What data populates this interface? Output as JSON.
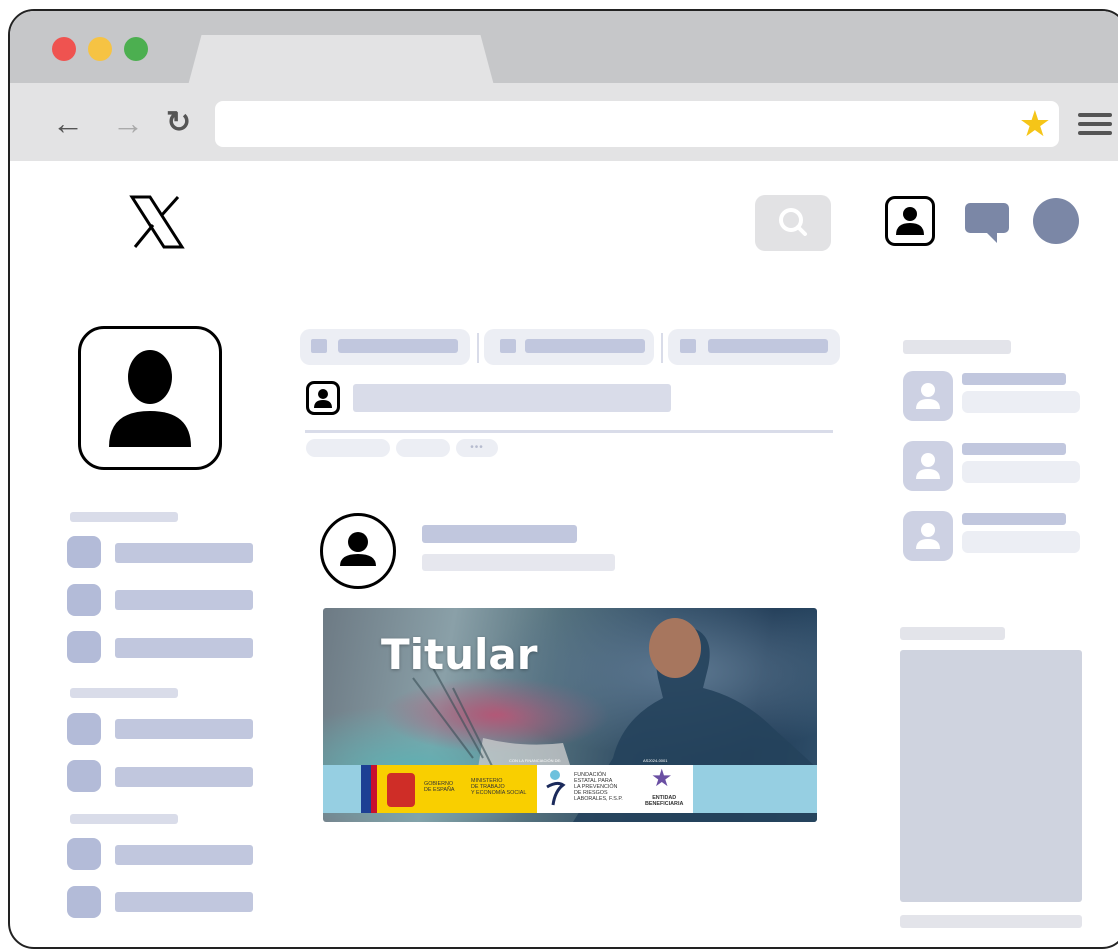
{
  "browser": {
    "traffic_lights": [
      "#ef5350",
      "#f6c343",
      "#4caf50"
    ],
    "back_icon": "arrow-left-icon",
    "forward_icon": "arrow-right-icon",
    "reload_icon": "reload-icon",
    "bookmark_icon": "star-icon",
    "menu_icon": "hamburger-menu-icon"
  },
  "app": {
    "logo": "X",
    "accent": "#b3bbd8"
  },
  "post": {
    "image_title": "Titular",
    "banner": {
      "top_left": "CON LA FINANCIACIÓN DE:",
      "top_right": "AS2024-0001",
      "gobierno": "GOBIERNO\nDE ESPAÑA",
      "ministerio": "MINISTERIO\nDE TRABAJO\nY ECONOMÍA SOCIAL",
      "fundacion": "FUNDACIÓN\nESTATAL PARA\nLA PREVENCIÓN\nDE RIESGOS\nLABORALES, F.S.P.",
      "entidad": "ENTIDAD\nBENEFICIARIA"
    }
  }
}
